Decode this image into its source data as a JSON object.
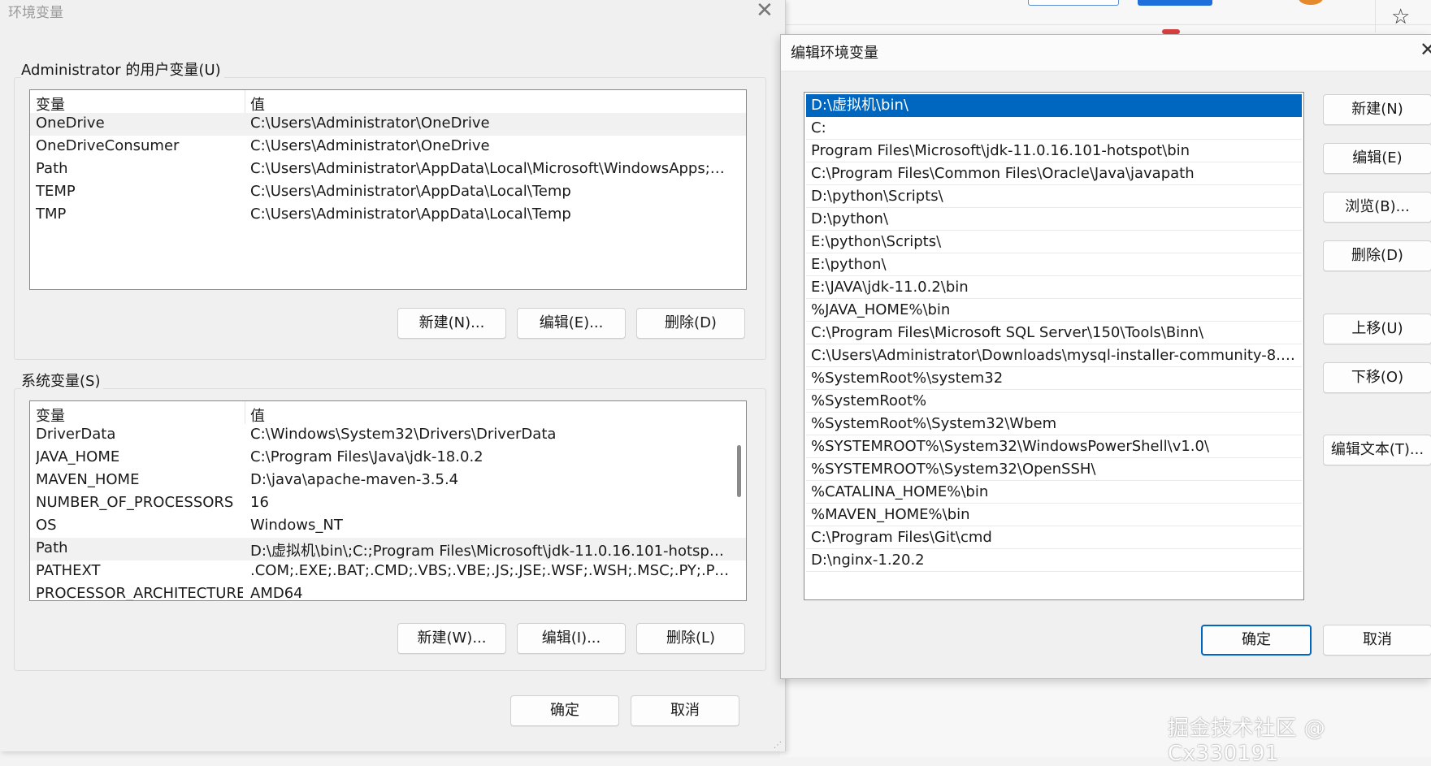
{
  "env_dialog": {
    "title": "环境变量",
    "close_glyph": "✕",
    "user_group_label": "Administrator 的用户变量(U)",
    "user_columns": [
      "变量",
      "值"
    ],
    "user_vars": [
      {
        "name": "OneDrive",
        "value": "C:\\Users\\Administrator\\OneDrive"
      },
      {
        "name": "OneDriveConsumer",
        "value": "C:\\Users\\Administrator\\OneDrive"
      },
      {
        "name": "Path",
        "value": "C:\\Users\\Administrator\\AppData\\Local\\Microsoft\\WindowsApps;C..."
      },
      {
        "name": "TEMP",
        "value": "C:\\Users\\Administrator\\AppData\\Local\\Temp"
      },
      {
        "name": "TMP",
        "value": "C:\\Users\\Administrator\\AppData\\Local\\Temp"
      }
    ],
    "user_buttons": {
      "new": "新建(N)...",
      "edit": "编辑(E)...",
      "delete": "删除(D)"
    },
    "system_group_label": "系统变量(S)",
    "system_columns": [
      "变量",
      "值"
    ],
    "system_vars": [
      {
        "name": "DriverData",
        "value": "C:\\Windows\\System32\\Drivers\\DriverData"
      },
      {
        "name": "JAVA_HOME",
        "value": "C:\\Program Files\\Java\\jdk-18.0.2"
      },
      {
        "name": "MAVEN_HOME",
        "value": "D:\\java\\apache-maven-3.5.4"
      },
      {
        "name": "NUMBER_OF_PROCESSORS",
        "value": "16"
      },
      {
        "name": "OS",
        "value": "Windows_NT"
      },
      {
        "name": "Path",
        "value": "D:\\虚拟机\\bin\\;C:;Program Files\\Microsoft\\jdk-11.0.16.101-hotspot..."
      },
      {
        "name": "PATHEXT",
        "value": ".COM;.EXE;.BAT;.CMD;.VBS;.VBE;.JS;.JSE;.WSF;.WSH;.MSC;.PY;.PYW"
      },
      {
        "name": "PROCESSOR_ARCHITECTURE",
        "value": "AMD64"
      }
    ],
    "system_buttons": {
      "new": "新建(W)...",
      "edit": "编辑(I)...",
      "delete": "删除(L)"
    },
    "ok": "确定",
    "cancel": "取消"
  },
  "edit_dialog": {
    "title": "编辑环境变量",
    "close_glyph": "✕",
    "paths": [
      "D:\\虚拟机\\bin\\",
      "C:",
      "Program Files\\Microsoft\\jdk-11.0.16.101-hotspot\\bin",
      "C:\\Program Files\\Common Files\\Oracle\\Java\\javapath",
      "D:\\python\\Scripts\\",
      "D:\\python\\",
      "E:\\python\\Scripts\\",
      "E:\\python\\",
      "E:\\JAVA\\jdk-11.0.2\\bin",
      "%JAVA_HOME%\\bin",
      "C:\\Program Files\\Microsoft SQL Server\\150\\Tools\\Binn\\",
      "C:\\Users\\Administrator\\Downloads\\mysql-installer-community-8.0.4...",
      "%SystemRoot%\\system32",
      "%SystemRoot%",
      "%SystemRoot%\\System32\\Wbem",
      "%SYSTEMROOT%\\System32\\WindowsPowerShell\\v1.0\\",
      "%SYSTEMROOT%\\System32\\OpenSSH\\",
      "%CATALINA_HOME%\\bin",
      "%MAVEN_HOME%\\bin",
      "C:\\Program Files\\Git\\cmd",
      "D:\\nginx-1.20.2"
    ],
    "buttons": {
      "new": "新建(N)",
      "edit": "编辑(E)",
      "browse": "浏览(B)...",
      "delete": "删除(D)",
      "move_up": "上移(U)",
      "move_down": "下移(O)",
      "edit_text": "编辑文本(T)...",
      "ok": "确定",
      "cancel": "取消"
    }
  },
  "browser": {
    "star_glyph": "☆"
  },
  "watermark": "掘金技术社区 @ Cx330191"
}
